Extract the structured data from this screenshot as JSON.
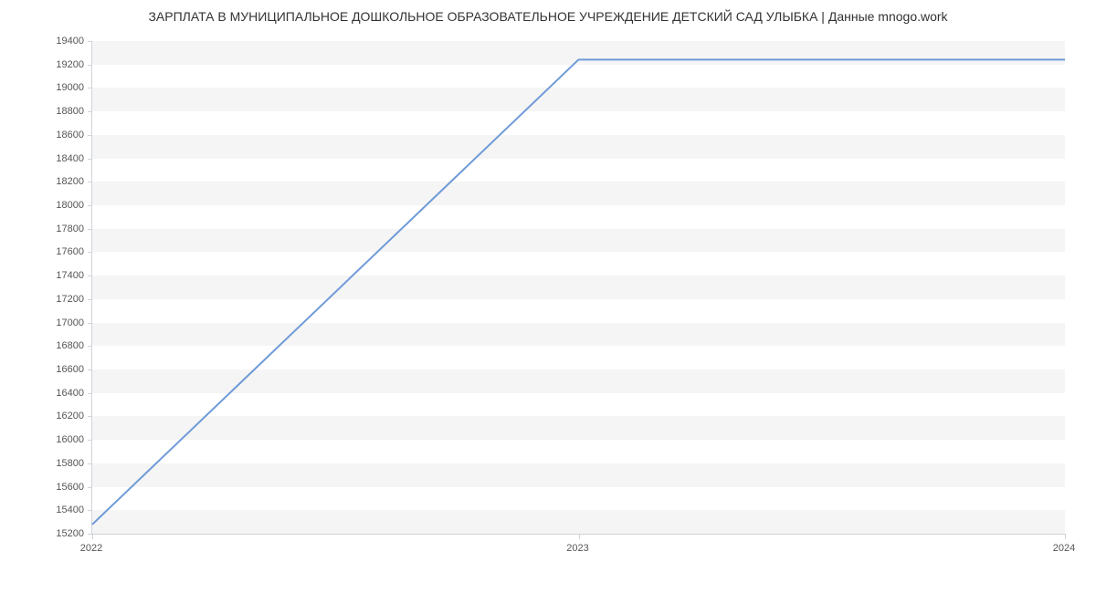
{
  "chart_data": {
    "type": "line",
    "title": "ЗАРПЛАТА В МУНИЦИПАЛЬНОЕ ДОШКОЛЬНОЕ ОБРАЗОВАТЕЛЬНОЕ УЧРЕЖДЕНИЕ  ДЕТСКИЙ САД УЛЫБКА | Данные mnogo.work",
    "x": [
      2022,
      2023,
      2024
    ],
    "values": [
      15279,
      19242,
      19242
    ],
    "xlabel": "",
    "ylabel": "",
    "ylim": [
      15200,
      19400
    ],
    "yticks": [
      15200,
      15400,
      15600,
      15800,
      16000,
      16200,
      16400,
      16600,
      16800,
      17000,
      17200,
      17400,
      17600,
      17800,
      18000,
      18200,
      18400,
      18600,
      18800,
      19000,
      19200,
      19400
    ],
    "xticks": [
      2022,
      2023,
      2024
    ],
    "line_color": "#6f9bd8"
  }
}
